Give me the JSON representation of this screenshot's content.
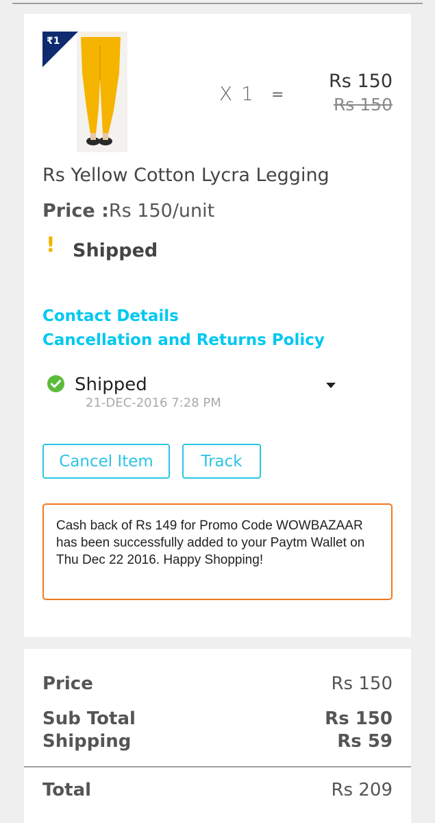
{
  "product": {
    "badge": "₹1",
    "quantity": "X 1",
    "equals": "=",
    "price_now": "Rs 150",
    "price_was": "Rs 150",
    "name": "Rs Yellow Cotton Lycra Legging",
    "unit_price_label": "Price :",
    "unit_price_value": "Rs 150/unit",
    "status_icon": "!",
    "status": "Shipped"
  },
  "links": {
    "contact": "Contact Details",
    "policy": "Cancellation and Returns Policy"
  },
  "tracking": {
    "status": "Shipped",
    "date": "21-DEC-2016 7:28 PM"
  },
  "actions": {
    "cancel": "Cancel Item",
    "track": "Track"
  },
  "promo": {
    "message": "Cash back of Rs 149 for Promo Code WOWBAZAAR has been successfully added to your Paytm Wallet on Thu Dec 22 2016. Happy Shopping!"
  },
  "summary": {
    "price_label": "Price",
    "price_value": "Rs 150",
    "subtotal_label": "Sub Total",
    "subtotal_value": "Rs 150",
    "shipping_label": "Shipping",
    "shipping_value": "Rs 59",
    "total_label": "Total",
    "total_value": "Rs 209"
  },
  "colors": {
    "link": "#00c8f0",
    "button_border": "#29c4e6",
    "promo_border": "#f0781e",
    "badge": "#0f2a6e",
    "check": "#5cbc3a",
    "warning": "#f4b400"
  }
}
